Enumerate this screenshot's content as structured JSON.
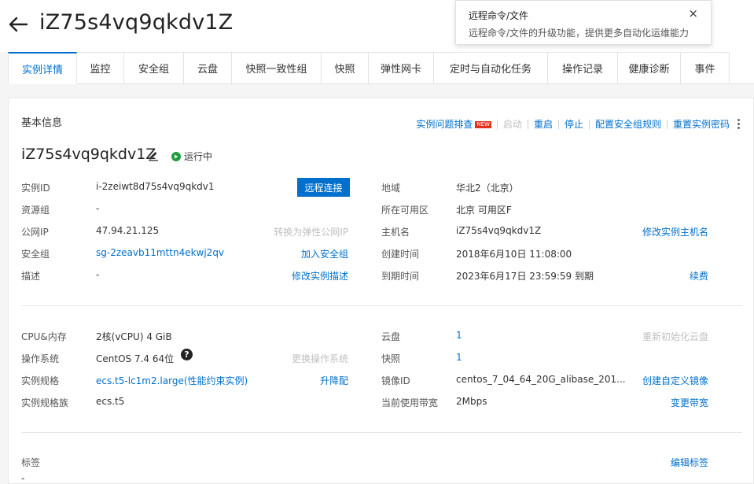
{
  "header": {
    "title": "iZ75s4vq9qkdv1Z"
  },
  "popover": {
    "title": "远程命令/文件",
    "text": "远程命令/文件的升级功能，提供更多自动化运维能力",
    "close": "×"
  },
  "tabs": [
    {
      "label": "实例详情",
      "active": true
    },
    {
      "label": "监控"
    },
    {
      "label": "安全组"
    },
    {
      "label": "云盘"
    },
    {
      "label": "快照一致性组"
    },
    {
      "label": "快照"
    },
    {
      "label": "弹性网卡"
    },
    {
      "label": "定时与自动化任务"
    },
    {
      "label": "操作记录"
    },
    {
      "label": "健康诊断"
    },
    {
      "label": "事件"
    }
  ],
  "basic": {
    "section_title": "基本信息",
    "actions": {
      "troubleshoot": "实例问题排查",
      "new_badge": "NEW",
      "start": "启动",
      "restart": "重启",
      "stop": "停止",
      "config_sg": "配置安全组规则",
      "reset_pwd": "重置实例密码"
    },
    "instance_name": "iZ75s4vq9qkdv1Z",
    "status": "运行中",
    "remote_connect": "远程连接",
    "left": {
      "instance_id_label": "实例ID",
      "instance_id": "i-2zeiwt8d75s4vq9qkdv1",
      "resource_group_label": "资源组",
      "resource_group": "-",
      "public_ip_label": "公网IP",
      "public_ip": "47.94.21.125",
      "convert_eip": "转换为弹性公网IP",
      "sg_label": "安全组",
      "sg_value": "sg-2zeavb11mttn4ekwj2qv",
      "join_sg": "加入安全组",
      "desc_label": "描述",
      "desc_value": "-",
      "edit_desc": "修改实例描述"
    },
    "right": {
      "region_label": "地域",
      "region": "华北2（北京）",
      "zone_label": "所在可用区",
      "zone": "北京 可用区F",
      "hostname_label": "主机名",
      "hostname": "iZ75s4vq9qkdv1Z",
      "edit_hostname": "修改实例主机名",
      "created_label": "创建时间",
      "created": "2018年6月10日 11:08:00",
      "expire_label": "到期时间",
      "expire": "2023年6月17日 23:59:59 到期",
      "renew": "续费"
    }
  },
  "config": {
    "left": {
      "cpu_label": "CPU&内存",
      "cpu": "2核(vCPU) 4 GiB",
      "os_label": "操作系统",
      "os": "CentOS 7.4 64位",
      "change_os": "更换操作系统",
      "spec_label": "实例规格",
      "spec": "ecs.t5-lc1m2.large(性能约束实例)",
      "upgrade": "升降配",
      "family_label": "实例规格族",
      "family": "ecs.t5"
    },
    "right": {
      "disk_label": "云盘",
      "disk": "1",
      "reinit_disk": "重新初始化云盘",
      "snapshot_label": "快照",
      "snapshot": "1",
      "image_label": "镜像ID",
      "image": "centos_7_04_64_20G_alibase_201...",
      "create_image": "创建自定义镜像",
      "bandwidth_label": "当前使用带宽",
      "bandwidth": "2Mbps",
      "change_bw": "变更带宽"
    }
  },
  "tags": {
    "label": "标签",
    "edit": "编辑标签",
    "value": "-"
  }
}
